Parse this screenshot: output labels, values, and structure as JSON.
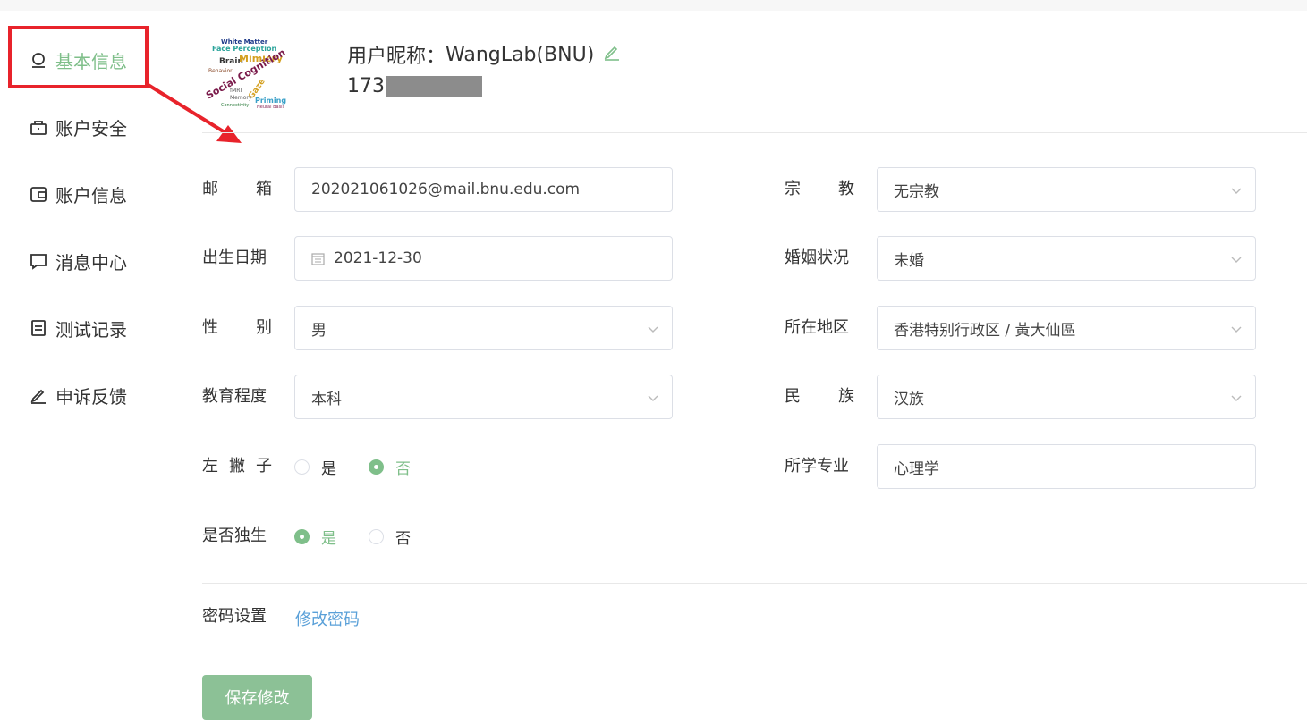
{
  "sidebar": {
    "items": [
      {
        "label": "基本信息",
        "icon": "user-circle-icon",
        "active": true
      },
      {
        "label": "账户安全",
        "icon": "lock-icon"
      },
      {
        "label": "账户信息",
        "icon": "wallet-icon"
      },
      {
        "label": "消息中心",
        "icon": "message-icon"
      },
      {
        "label": "测试记录",
        "icon": "document-icon"
      },
      {
        "label": "申诉反馈",
        "icon": "edit-icon"
      }
    ]
  },
  "profile": {
    "nickname_label": "用户昵称：",
    "nickname": "WangLab(BNU)",
    "phone_prefix": "173",
    "avatar_words": [
      "White Matter",
      "Face Perception",
      "Brain",
      "Mimicry",
      "Social Cognition",
      "Gaze",
      "Priming",
      "fMRI",
      "Memory",
      "Behavior"
    ]
  },
  "form": {
    "email": {
      "label": "邮 箱",
      "value": "202021061026@mail.bnu.edu.com"
    },
    "birthdate": {
      "label": "出生日期",
      "value": "2021-12-30"
    },
    "gender": {
      "label": "性 别",
      "value": "男"
    },
    "education": {
      "label": "教育程度",
      "value": "本科"
    },
    "left_handed": {
      "label": "左 撇 子",
      "options": [
        "是",
        "否"
      ],
      "selected": "否"
    },
    "only_child": {
      "label": "是否独生",
      "options": [
        "是",
        "否"
      ],
      "selected": "是"
    },
    "religion": {
      "label": "宗 教",
      "value": "无宗教"
    },
    "marital": {
      "label": "婚姻状况",
      "value": "未婚"
    },
    "region": {
      "label": "所在地区",
      "value": "香港特别行政区 / 黃大仙區"
    },
    "ethnicity": {
      "label": "民 族",
      "value": "汉族"
    },
    "major": {
      "label": "所学专业",
      "value": "心理学"
    }
  },
  "password": {
    "label": "密码设置",
    "link": "修改密码"
  },
  "save_label": "保存修改",
  "colors": {
    "accent": "#7fbf8a",
    "button": "#8cc196",
    "link": "#5aa0d8",
    "annotation": "#e8232b"
  }
}
